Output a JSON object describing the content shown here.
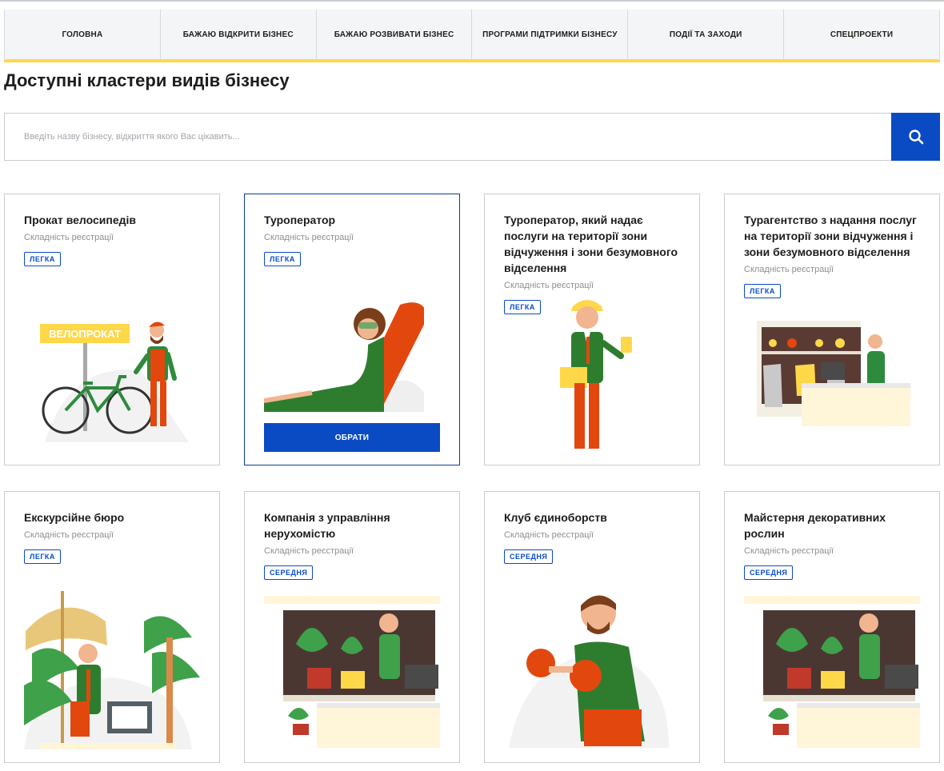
{
  "nav": [
    {
      "label": "ГОЛОВНА"
    },
    {
      "label": "БАЖАЮ ВІДКРИТИ БІЗНЕС"
    },
    {
      "label": "БАЖАЮ РОЗВИВАТИ БІЗНЕС"
    },
    {
      "label": "ПРОГРАМИ ПІДТРИМКИ БІЗНЕСУ"
    },
    {
      "label": "ПОДІЇ ТА ЗАХОДИ"
    },
    {
      "label": "СПЕЦПРОЕКТИ"
    }
  ],
  "page_title": "Доступні кластери видів бізнесу",
  "search": {
    "placeholder": "Введіть назву бізнесу, відкриття якого Вас цікавить...",
    "icon": "search-icon"
  },
  "cards": [
    {
      "title": "Прокат велосипедів",
      "subtitle": "Складність реєстрації",
      "badge": "ЛЕГКА",
      "sign": "ВЕЛОПРОКАТ",
      "icon": "bike-rental-illustration"
    },
    {
      "title": "Туроператор",
      "subtitle": "Складність реєстрації",
      "badge": "ЛЕГКА",
      "button": "ОБРАТИ",
      "icon": "lounging-woman-illustration"
    },
    {
      "title": "Туроператор, який надає послуги на території зони відчуження і зони безумовного відселення",
      "subtitle": "Складність реєстрації",
      "badge": "ЛЕГКА",
      "icon": "worker-with-dosimeter-illustration"
    },
    {
      "title": "Турагентство з надання послуг на території зони відчуження і зони безумовного відселення",
      "subtitle": "Складність реєстрації",
      "badge": "ЛЕГКА",
      "icon": "clothing-shop-illustration"
    },
    {
      "title": "Екскурсійне бюро",
      "subtitle": "Складність реєстрації",
      "badge": "ЛЕГКА",
      "icon": "tropical-office-illustration"
    },
    {
      "title": "Компанія з управління нерухомістю",
      "subtitle": "Складність реєстрації",
      "badge": "СЕРЕДНЯ",
      "icon": "plant-shop-illustration"
    },
    {
      "title": "Клуб єдиноборств",
      "subtitle": "Складність реєстрації",
      "badge": "СЕРЕДНЯ",
      "icon": "boxer-illustration"
    },
    {
      "title": "Майстерня декоративних рослин",
      "subtitle": "Складність реєстрації",
      "badge": "СЕРЕДНЯ",
      "icon": "plant-shop-illustration"
    }
  ],
  "colors": {
    "accent": "#0a4bc4",
    "nav_underline": "#ffd84a",
    "orange": "#e2470e",
    "green": "#2e8b3d"
  }
}
